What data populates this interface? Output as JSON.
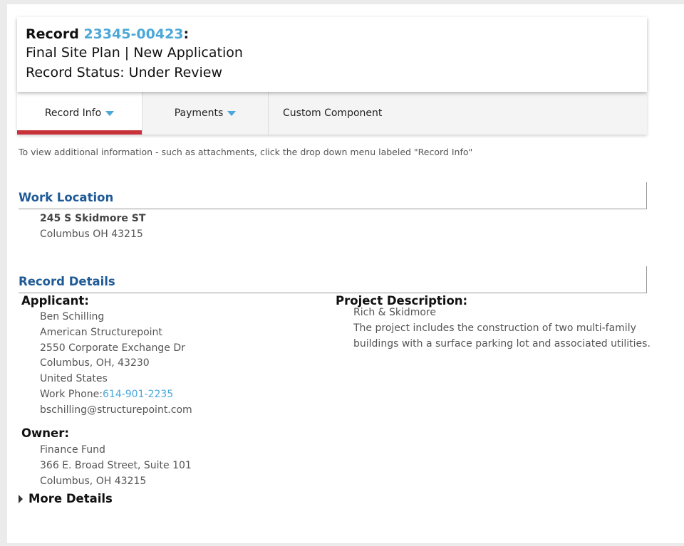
{
  "header": {
    "record_label": "Record",
    "record_number": "23345-00423",
    "colon": ":",
    "subtitle": "Final Site Plan | New Application",
    "status": "Record Status: Under Review"
  },
  "tabs": [
    {
      "label": "Record Info",
      "has_dropdown": true,
      "active": true
    },
    {
      "label": "Payments",
      "has_dropdown": true,
      "active": false
    },
    {
      "label": "Custom Component",
      "has_dropdown": false,
      "active": false
    }
  ],
  "hint": "To view additional information - such as attachments, click the drop down menu labeled \"Record Info\"",
  "work_location": {
    "title": "Work Location",
    "street": "245 S Skidmore ST",
    "city": "Columbus OH 43215"
  },
  "record_details": {
    "title": "Record Details",
    "applicant": {
      "label": "Applicant:",
      "name": "Ben Schilling",
      "company": "American Structurepoint",
      "address1": "2550 Corporate Exchange Dr",
      "address2": "Columbus, OH, 43230",
      "country": "United States",
      "phone_label": "Work Phone:",
      "phone": "614-901-2235",
      "email": "bschilling@structurepoint.com"
    },
    "owner": {
      "label": "Owner:",
      "name": "Finance Fund",
      "address1": "366 E. Broad Street, Suite 101",
      "address2": "Columbus, OH 43215"
    },
    "project": {
      "label": "Project Description:",
      "name": "Rich & Skidmore",
      "description": "The project includes the construction of two multi-family buildings with a surface parking lot and associated utilities."
    },
    "more_details": "More Details"
  },
  "colors": {
    "accent_blue": "#4aa8d8",
    "section_blue": "#1f5a96",
    "active_tab_red": "#c8323a"
  }
}
